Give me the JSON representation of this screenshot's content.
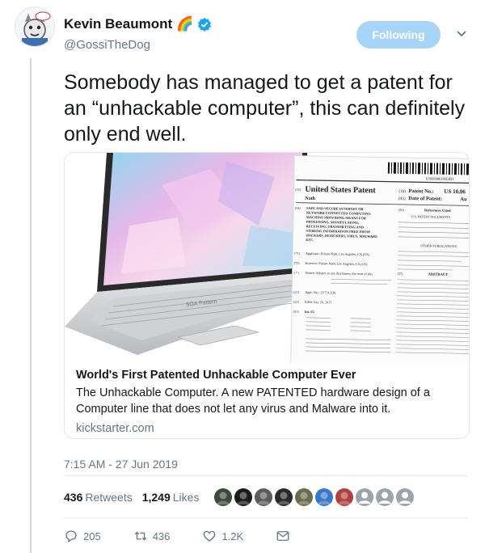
{
  "author": {
    "name": "Kevin Beaumont",
    "name_emoji": "🌈",
    "handle": "@GossiTheDog",
    "avatar_icon": "cartoon-animal-avatar",
    "verified_icon": "verified-badge-icon"
  },
  "follow_button": {
    "label": "Following"
  },
  "tweet": {
    "text": "Somebody has managed to get a patent for an “unhackable computer”, this can definitely only end well."
  },
  "card": {
    "title": "World's First Patented Unhackable Computer Ever",
    "description": "The Unhackable Computer. A new PATENTED hardware design of a Computer line that does not let any virus and Malware into it.",
    "domain": "kickstarter.com",
    "image": {
      "laptop_brand": "SGA Pattern",
      "patent_header": "United States Patent",
      "patent_inventor": "Nath",
      "patent_no_label": "Patent No.:",
      "patent_no": "US 10,06",
      "patent_date_label": "Date of Patent:",
      "patent_date": "Au",
      "barcode_number": "US010061923B1",
      "refs_title": "References Cited",
      "refs_sub": "U.S. PATENT DOCUMENTS",
      "other_pubs": "OTHER PUBLICATIONS",
      "abstract": "ABSTRACT",
      "patent_title_lines": [
        "SAFE AND SECURE INTERNET OR",
        "NETWORK CONNECTED COMPUTING",
        "MACHINE PROVIDING MEANS FOR",
        "PROCESSING, MANIPULATING,",
        "RECEIVING, TRANSMITTING AND",
        "STORING INFORMATION FREE FROM",
        "HACKERS, HIJACKERS, VIRUS, MALWARE",
        "ETC."
      ],
      "applicant": "Applicant:  Pritam Nath, Los Angeles, CA (US)",
      "inventor": "Inventor:  Pritam Nath, Los Angeles, CA (US)",
      "notice": "Notice:  Subject to any disclaimer, the term of this",
      "appl_no": "Appl. No.: 15/731,536",
      "filed": "Filed:  Jun. 26, 2017",
      "int_cl": "Int. Cl."
    }
  },
  "timestamp": "7:15 AM - 27 Jun 2019",
  "stats": {
    "retweets_count": "436",
    "retweets_label": "Retweets",
    "likes_count": "1,249",
    "likes_label": "Likes"
  },
  "likers_colors": [
    "#3d4a3a",
    "#1b1b1b",
    "#5c5c5c",
    "#2a2a2a",
    "#6b6b4f",
    "#3c78c8",
    "#b04040",
    "#9aa5ae",
    "#9aa5ae",
    "#9aa5ae"
  ],
  "actions": {
    "reply_count": "205",
    "retweet_count": "436",
    "like_count": "1.2K"
  }
}
